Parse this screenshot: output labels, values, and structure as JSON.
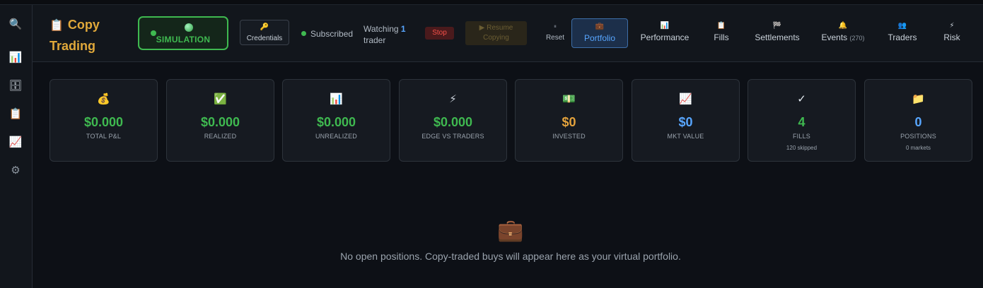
{
  "rail": {
    "icons": [
      {
        "name": "search-icon",
        "glyph": "🔍"
      },
      {
        "name": "bar-chart-icon",
        "glyph": "📊"
      },
      {
        "name": "database-icon",
        "glyph": "🗄"
      },
      {
        "name": "clipboard-icon",
        "glyph": "📋"
      },
      {
        "name": "line-chart-icon",
        "glyph": "📈"
      },
      {
        "name": "gear-icon",
        "glyph": "⚙"
      }
    ]
  },
  "header": {
    "brand_icon": "📋",
    "brand_line1": "Copy",
    "brand_line2": "Trading",
    "mode_label": "SIMULATION",
    "credentials_icon": "🔑",
    "credentials_label": "Credentials",
    "status_text": "Subscribed",
    "watching_prefix": "Watching",
    "watching_count": "1",
    "watching_suffix": "trader",
    "stop_label": "Stop",
    "resume_label_line1": "▶ Resume",
    "resume_label_line2": "Copying",
    "reset_icon": "⏸",
    "reset_label": "Reset"
  },
  "tabs": [
    {
      "key": "portfolio",
      "icon": "💼",
      "label": "Portfolio",
      "count": "",
      "active": true
    },
    {
      "key": "performance",
      "icon": "📊",
      "label": "Performance",
      "count": "",
      "active": false
    },
    {
      "key": "fills",
      "icon": "📋",
      "label": "Fills",
      "count": "",
      "active": false
    },
    {
      "key": "settlements",
      "icon": "🏁",
      "label": "Settlements",
      "count": "",
      "active": false
    },
    {
      "key": "events",
      "icon": "🔔",
      "label": "Events",
      "count": "(270)",
      "active": false
    },
    {
      "key": "traders",
      "icon": "👥",
      "label": "Traders",
      "count": "",
      "active": false
    },
    {
      "key": "risk",
      "icon": "⚡",
      "label": "Risk",
      "count": "",
      "active": false
    }
  ],
  "cards": [
    {
      "key": "total-pnl",
      "icon": "💰",
      "value": "$0.000",
      "label": "TOTAL P&L",
      "sub": "",
      "color": "#3fb950"
    },
    {
      "key": "realized",
      "icon": "✅",
      "value": "$0.000",
      "label": "REALIZED",
      "sub": "",
      "color": "#3fb950"
    },
    {
      "key": "unrealized",
      "icon": "📊",
      "value": "$0.000",
      "label": "UNREALIZED",
      "sub": "",
      "color": "#3fb950"
    },
    {
      "key": "edge-vs-traders",
      "icon": "⚡",
      "value": "$0.000",
      "label": "EDGE VS TRADERS",
      "sub": "",
      "color": "#3fb950"
    },
    {
      "key": "invested",
      "icon": "💵",
      "value": "$0",
      "label": "INVESTED",
      "sub": "",
      "color": "#e3a23c"
    },
    {
      "key": "mkt-value",
      "icon": "📈",
      "value": "$0",
      "label": "MKT VALUE",
      "sub": "",
      "color": "#58a6ff"
    },
    {
      "key": "fills",
      "icon": "✓",
      "value": "4",
      "label": "FILLS",
      "sub": "120 skipped",
      "color": "#3fb950"
    },
    {
      "key": "positions",
      "icon": "📁",
      "value": "0",
      "label": "POSITIONS",
      "sub": "0 markets",
      "color": "#58a6ff"
    }
  ],
  "empty_state": {
    "icon": "💼",
    "message": "No open positions. Copy-traded buys will appear here as your virtual portfolio."
  },
  "colors": {
    "accent_green": "#3fb950",
    "accent_blue": "#58a6ff",
    "accent_orange": "#e3a23c",
    "stop_red": "#f85149",
    "brand_gold": "#e0a83a"
  }
}
